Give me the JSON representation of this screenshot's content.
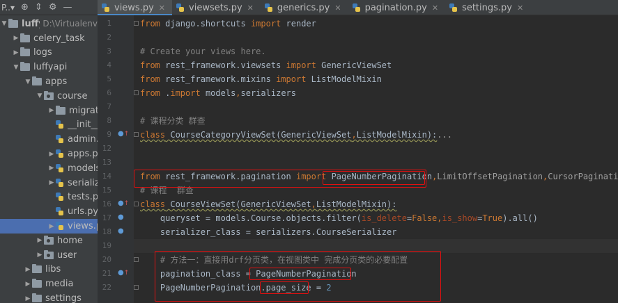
{
  "project_panel": {
    "title": "P..▾",
    "toolbar_icons": [
      "globe-icon",
      "collapse-icon",
      "gear-icon",
      "minimize-icon"
    ],
    "tree": [
      {
        "label": "luffyapi",
        "extra": "D:\\Virtualenv",
        "depth": 0,
        "type": "folder",
        "expanded": true,
        "bold": true
      },
      {
        "label": "celery_task",
        "depth": 1,
        "type": "folder",
        "expanded": false
      },
      {
        "label": "logs",
        "depth": 1,
        "type": "folder",
        "expanded": false
      },
      {
        "label": "luffyapi",
        "depth": 1,
        "type": "folder",
        "expanded": true
      },
      {
        "label": "apps",
        "depth": 2,
        "type": "folder",
        "expanded": true
      },
      {
        "label": "course",
        "depth": 3,
        "type": "package",
        "expanded": true
      },
      {
        "label": "migrations",
        "depth": 4,
        "type": "folder",
        "expanded": false
      },
      {
        "label": "__init__.py",
        "depth": 4,
        "type": "py"
      },
      {
        "label": "admin.py",
        "depth": 4,
        "type": "py"
      },
      {
        "label": "apps.py",
        "depth": 4,
        "type": "py",
        "expandable": true
      },
      {
        "label": "models.py",
        "depth": 4,
        "type": "py",
        "expandable": true
      },
      {
        "label": "serializers",
        "depth": 4,
        "type": "py",
        "expandable": true
      },
      {
        "label": "tests.py",
        "depth": 4,
        "type": "py"
      },
      {
        "label": "urls.py",
        "depth": 4,
        "type": "py"
      },
      {
        "label": "views.py",
        "depth": 4,
        "type": "py",
        "expandable": true,
        "selected": true
      },
      {
        "label": "home",
        "depth": 3,
        "type": "package",
        "expanded": false
      },
      {
        "label": "user",
        "depth": 3,
        "type": "package",
        "expanded": false
      },
      {
        "label": "libs",
        "depth": 2,
        "type": "folder",
        "expanded": false
      },
      {
        "label": "media",
        "depth": 2,
        "type": "folder",
        "expanded": false
      },
      {
        "label": "settings",
        "depth": 2,
        "type": "folder",
        "expanded": false
      }
    ]
  },
  "tabs": [
    {
      "label": "views.py",
      "active": true
    },
    {
      "label": "viewsets.py"
    },
    {
      "label": "generics.py"
    },
    {
      "label": "pagination.py"
    },
    {
      "label": "settings.py"
    }
  ],
  "code_lines": [
    {
      "n": "1",
      "html": "<span class=\"kw\">from</span> django.shortcuts <span class=\"kw\">import</span> render"
    },
    {
      "n": "2",
      "html": ""
    },
    {
      "n": "3",
      "html": "<span class=\"cm\"># Create your views here.</span>"
    },
    {
      "n": "4",
      "html": "<span class=\"kw\">from</span> rest_framework.viewsets <span class=\"kw\">import</span> GenericViewSet"
    },
    {
      "n": "5",
      "html": "<span class=\"kw\">from</span> rest_framework.mixins <span class=\"kw\">import</span> ListModelMixin"
    },
    {
      "n": "6",
      "html": "<span class=\"kw\">from</span> .<span class=\"kw\">import</span> models<span class=\"kw\">,</span>serializers"
    },
    {
      "n": "7",
      "html": ""
    },
    {
      "n": "8",
      "html": "<span class=\"cm\"># 课程分类 群查</span>"
    },
    {
      "n": "9",
      "html": "<span class=\"kw wavy\">class</span><span class=\"wavy\"> CourseCategoryViewSet(GenericViewSet<span class=\"kw\">,</span>ListModelMixin):</span><span class=\"gray\">...</span>"
    },
    {
      "n": "12",
      "html": ""
    },
    {
      "n": "13",
      "html": ""
    },
    {
      "n": "14",
      "html": "<span class=\"kw\">from</span> rest_framework.pagination <span class=\"kw\">import</span> PageNumberPagination<span class=\"kw\">,</span><span class=\"gray\">LimitOffsetPagination</span><span class=\"kw\">,</span><span class=\"gray\">CursorPagination</span>"
    },
    {
      "n": "15",
      "html": "<span class=\"cm\"># 课程  群查</span>"
    },
    {
      "n": "16",
      "html": "<span class=\"kw wavy\">class</span><span class=\"wavy\"> CourseViewSet(GenericViewSet<span class=\"kw\">,</span>ListModelMixin):</span>"
    },
    {
      "n": "17",
      "html": "    queryset = models.Course.objects.filter(<span class=\"pm\">is_delete</span>=<span class=\"kw\">False</span><span class=\"kw\">,</span><span class=\"pm\">is_show</span>=<span class=\"kw\">True</span>).all()"
    },
    {
      "n": "18",
      "html": "    serializer_class = serializers.CourseSerializer"
    },
    {
      "n": "19",
      "html": ""
    },
    {
      "n": "20",
      "html": "    <span class=\"cm\"># 方法一：直接用drf分页类，在视图类中 完成分页类的必要配置</span>"
    },
    {
      "n": "21",
      "html": "    pagination_class = PageNumberPagination"
    },
    {
      "n": "22",
      "html": "    PageNumberPagination.page_size = <span class=\"num\">2</span>"
    }
  ]
}
